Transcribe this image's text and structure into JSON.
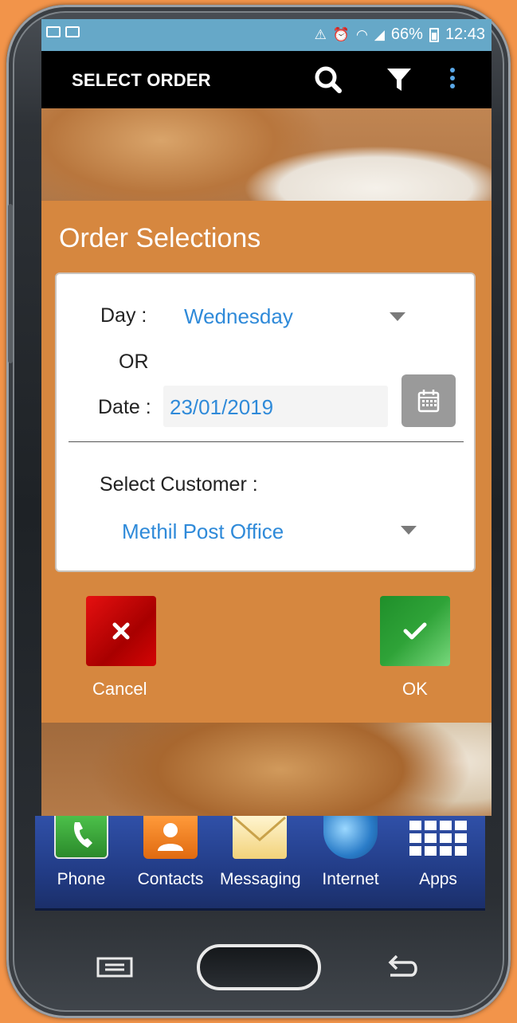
{
  "status_bar": {
    "battery": "66%",
    "time": "12:43"
  },
  "toolbar": {
    "title": "SELECT ORDER"
  },
  "dialog": {
    "title": "Order Selections",
    "day_label": "Day  :",
    "day_value": "Wednesday",
    "or_label": "OR",
    "date_label": "Date :",
    "date_value": "23/01/2019",
    "customer_label": "Select Customer :",
    "customer_value": "Methil Post Office",
    "cancel_label": "Cancel",
    "ok_label": "OK"
  },
  "dock": {
    "items": [
      {
        "label": "Phone",
        "icon": "phone-icon"
      },
      {
        "label": "Contacts",
        "icon": "contacts-icon"
      },
      {
        "label": "Messaging",
        "icon": "messaging-icon"
      },
      {
        "label": "Internet",
        "icon": "internet-icon"
      },
      {
        "label": "Apps",
        "icon": "apps-icon"
      }
    ]
  },
  "colors": {
    "dialog_bg": "#d6873f",
    "accent_text": "#2f8ad9",
    "status_bar": "#66a8c8",
    "cancel": "#d40505",
    "ok": "#2fa338"
  }
}
